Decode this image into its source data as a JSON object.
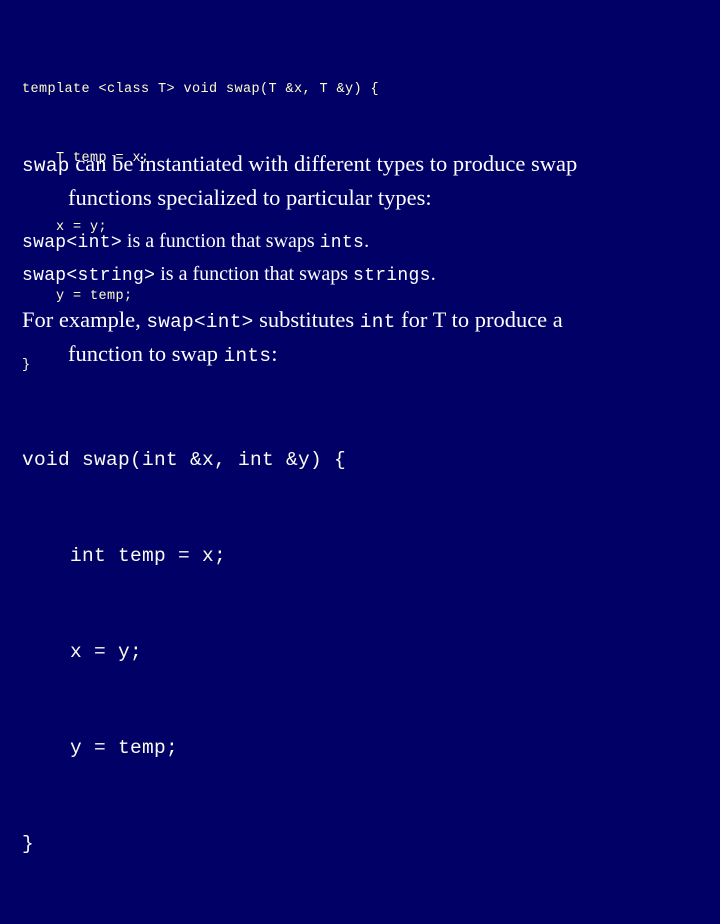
{
  "slide": {
    "background_color": "#000066",
    "code_color": "#ffffcc",
    "body_color": "#ffffff",
    "mono_body_color": "#fbfbef"
  },
  "code_top": {
    "lines": [
      "template <class T> void swap(T &x, T &y) {",
      "    T temp = x;",
      "    x = y;",
      "    y = temp;",
      "}"
    ]
  },
  "paragraph_1": {
    "mono_lead": "swap",
    "line1_rest": " can be instantiated with different types to produce swap",
    "line2": "functions specialized to particular types:"
  },
  "instantiations": [
    {
      "signature": "swap<int>",
      "text_mid": " is a function that swaps ",
      "type_name": "ints",
      "punctuation": "."
    },
    {
      "signature": "swap<string>",
      "text_mid": " is a function that swaps ",
      "type_name": "strings",
      "punctuation": "."
    }
  ],
  "paragraph_2": {
    "prefix": "For example, ",
    "signature": "swap<int>",
    "mid_1": " substitutes ",
    "type_1": "int",
    "mid_2": " for T to produce a",
    "line2_prefix": "function to swap ",
    "line2_type": "ints",
    "line2_suffix": ":"
  },
  "code_bottom": {
    "lines": [
      "void swap(int &x, int &y) {",
      "    int temp = x;",
      "    x = y;",
      "    y = temp;",
      "}"
    ]
  }
}
